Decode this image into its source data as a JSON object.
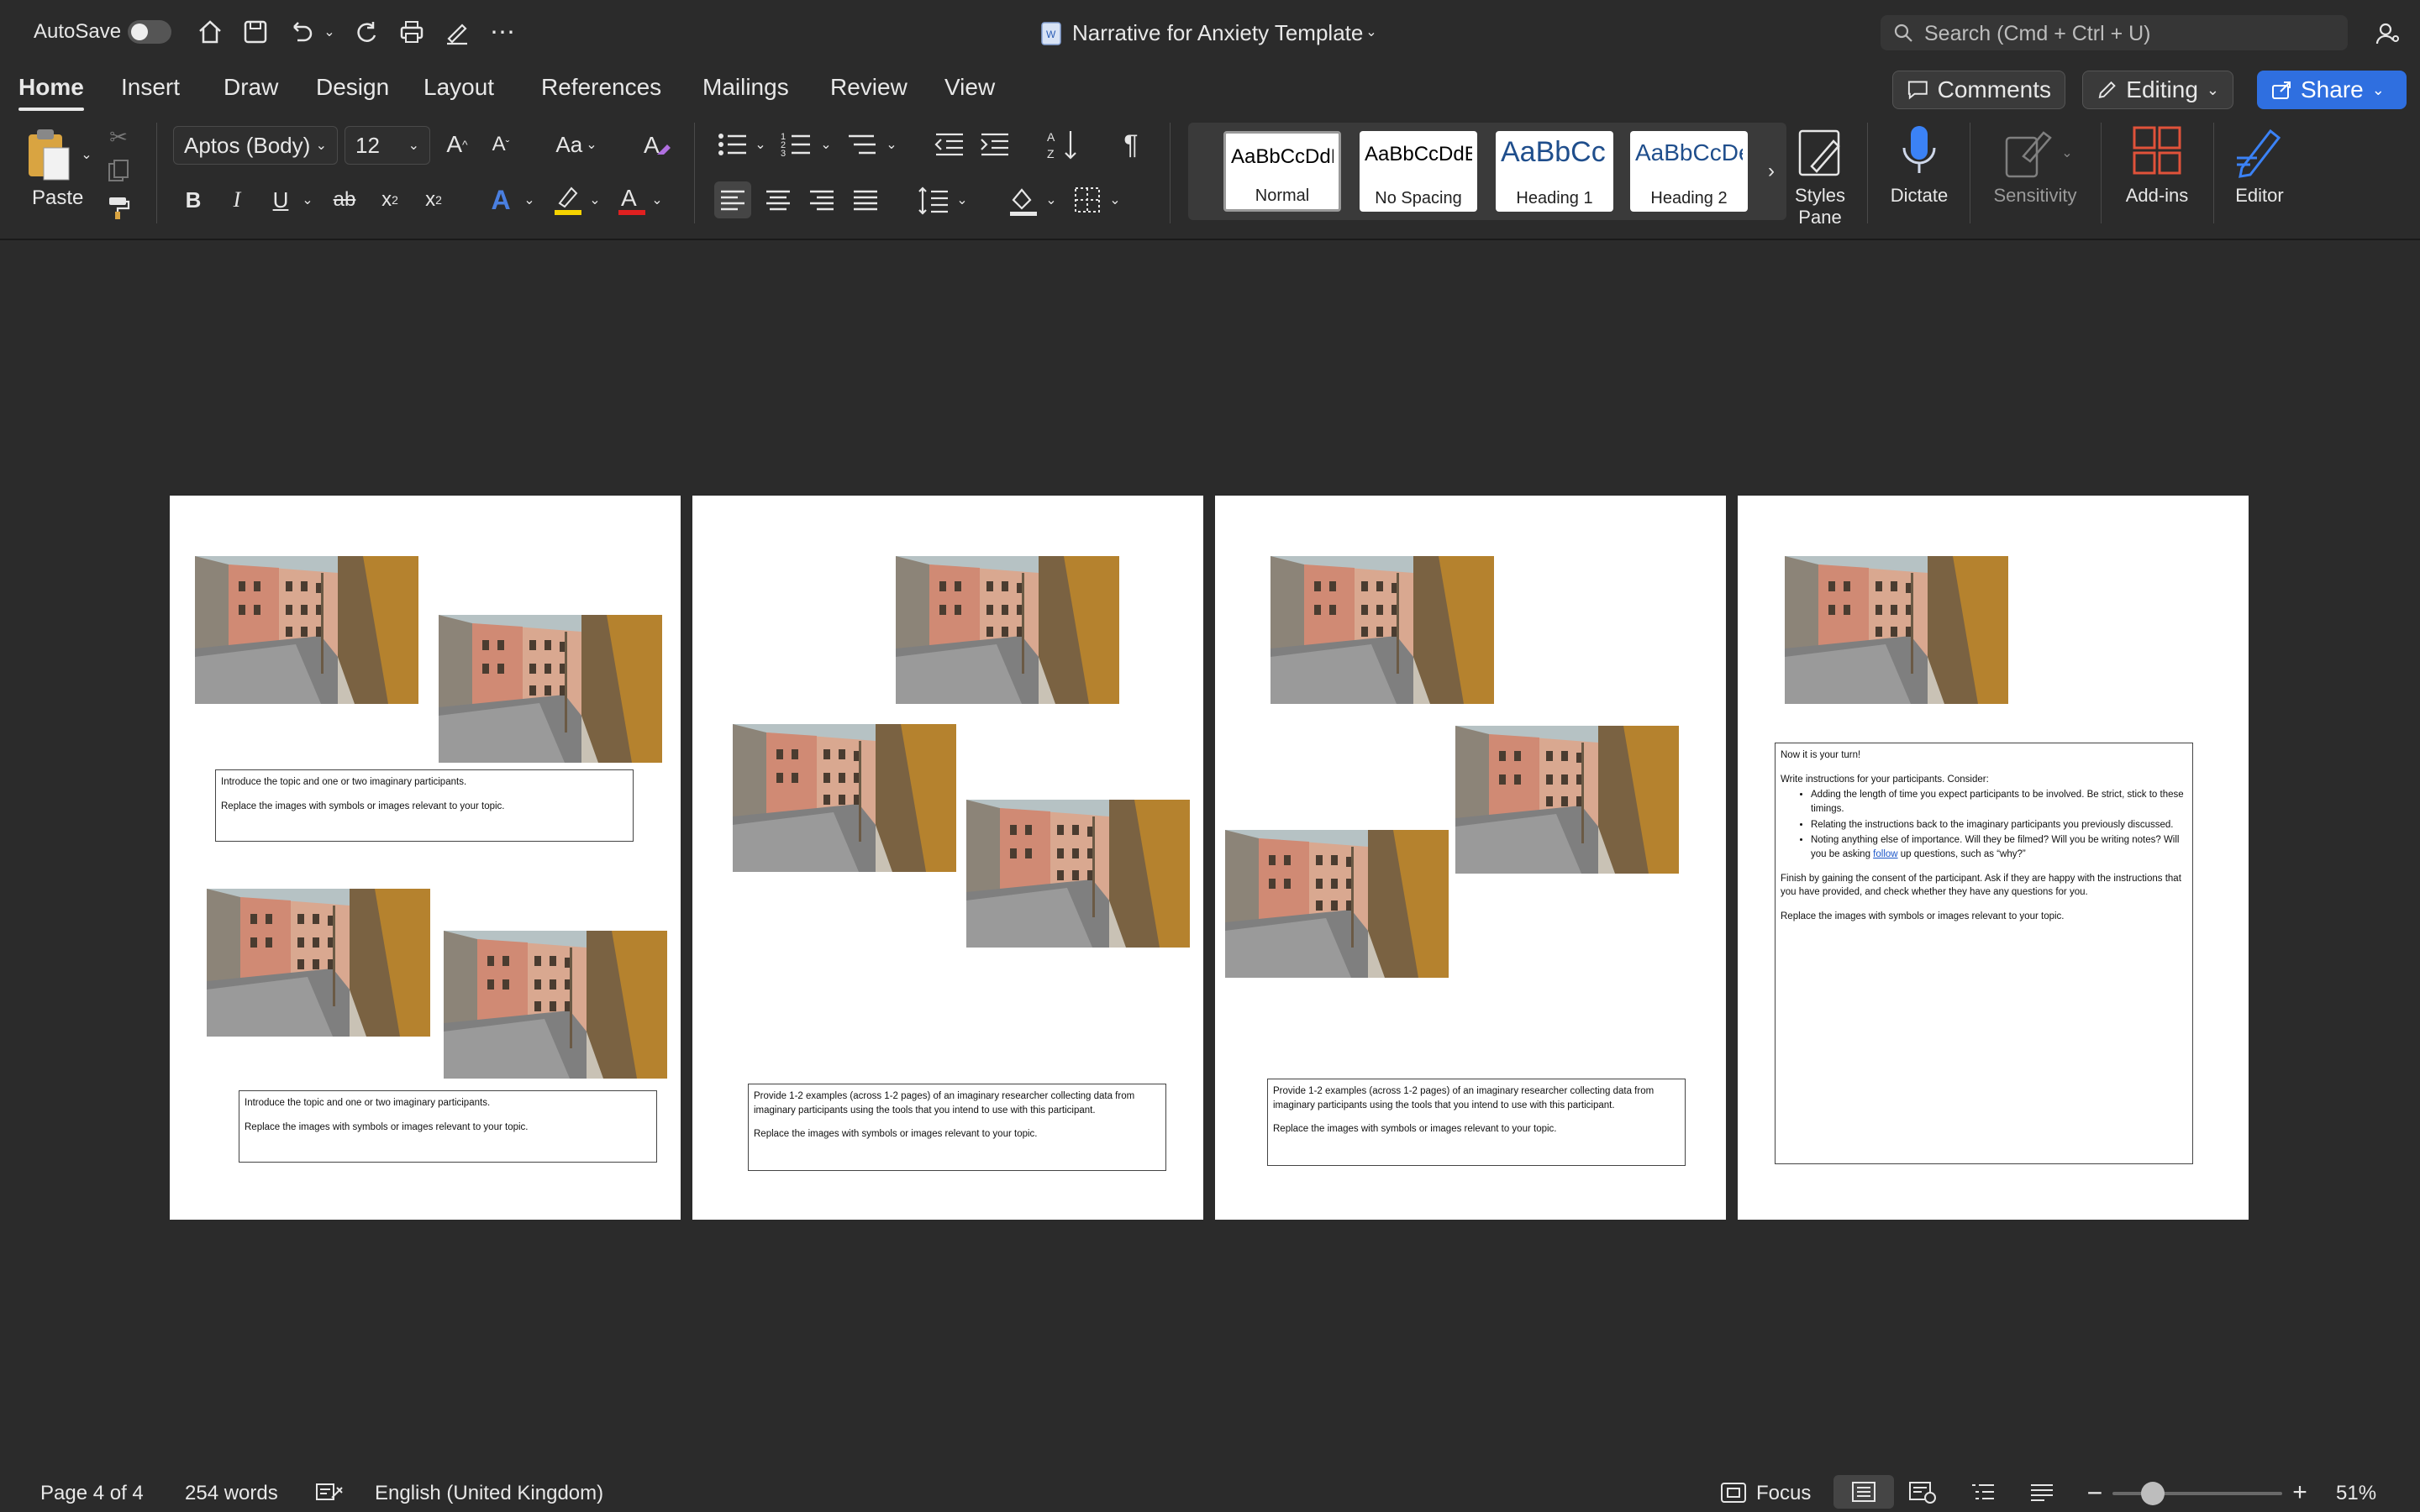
{
  "titlebar": {
    "autosave_label": "AutoSave",
    "doc_title": "Narrative for Anxiety Template",
    "search_placeholder": "Search (Cmd + Ctrl + U)"
  },
  "tabs": [
    "Home",
    "Insert",
    "Draw",
    "Design",
    "Layout",
    "References",
    "Mailings",
    "Review",
    "View"
  ],
  "header_buttons": {
    "comments": "Comments",
    "editing": "Editing",
    "share": "Share"
  },
  "ribbon": {
    "paste_label": "Paste",
    "font_name": "Aptos (Body)",
    "font_size": "12",
    "styles": [
      "Normal",
      "No Spacing",
      "Heading 1",
      "Heading 2"
    ],
    "style_sample": "AaBbCcDdEe",
    "heading_sample": "AaBbCc",
    "heading2_sample": "AaBbCcDe",
    "styles_pane": [
      "Styles",
      "Pane"
    ],
    "dictate": "Dictate",
    "sensitivity": "Sensitivity",
    "addins": "Add-ins",
    "editor": "Editor"
  },
  "pages": {
    "p1_box": [
      "Introduce the topic and one or two imaginary participants.",
      "Replace the images with symbols or images relevant to your topic."
    ],
    "p2_box": [
      "Provide 1-2 examples (across 1-2 pages) of an imaginary researcher collecting data from imaginary participants using the tools that you intend to use with this participant.",
      "Replace the images with symbols or images relevant to your topic."
    ],
    "p4_box": {
      "intro": "Now it is your turn!",
      "instructions": "Write instructions for your participants. Consider:",
      "bullets": [
        "Adding the length of time you expect participants to be involved. Be strict, stick to these timings.",
        "Relating the instructions back to the imaginary participants you previously discussed."
      ],
      "bullet3_pre": "Noting anything else of importance. Will they be filmed? Will you be writing notes? Will you be asking ",
      "bullet3_link": "follow",
      "bullet3_post": " up questions, such as “why?”",
      "finish": "Finish by gaining the consent of the participant. Ask if they are happy with the instructions that you have provided, and check whether they have any questions for you.",
      "replace": "Replace the images with symbols or images relevant to your topic."
    }
  },
  "status": {
    "page": "Page 4 of 4",
    "words": "254 words",
    "language": "English (United Kingdom)",
    "focus": "Focus",
    "zoom": "51%"
  },
  "colors": {
    "share_blue": "#2f6fe0",
    "highlight": "#f5d300",
    "font_red": "#e02020"
  }
}
